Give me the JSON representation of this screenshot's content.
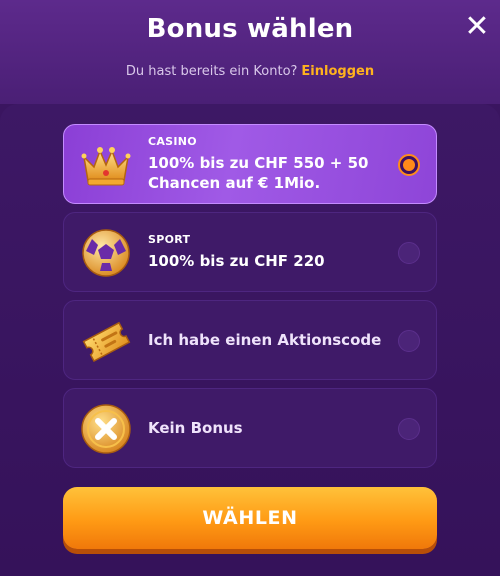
{
  "header": {
    "title": "Bonus wählen",
    "close_icon": "close-icon",
    "subtitle": "Du hast bereits ein Konto?",
    "login_link": "Einloggen"
  },
  "options": [
    {
      "tag": "CASINO",
      "line1": "100% bis zu CHF 550 + 50",
      "line2": "Chancen auf € 1Mio.",
      "icon": "crown-icon",
      "selected": true
    },
    {
      "tag": "SPORT",
      "line1": "100% bis zu CHF 220",
      "icon": "soccer-ball-icon",
      "selected": false
    },
    {
      "label": "Ich habe einen Aktionscode",
      "icon": "ticket-icon",
      "selected": false
    },
    {
      "label": "Kein Bonus",
      "icon": "no-bonus-coin-icon",
      "selected": false
    }
  ],
  "cta": {
    "label": "WÄHLEN"
  },
  "colors": {
    "accent": "#ff9a14",
    "link": "#ffb21e",
    "selected_bg": "#9a50e0",
    "background": "#3a1560"
  }
}
